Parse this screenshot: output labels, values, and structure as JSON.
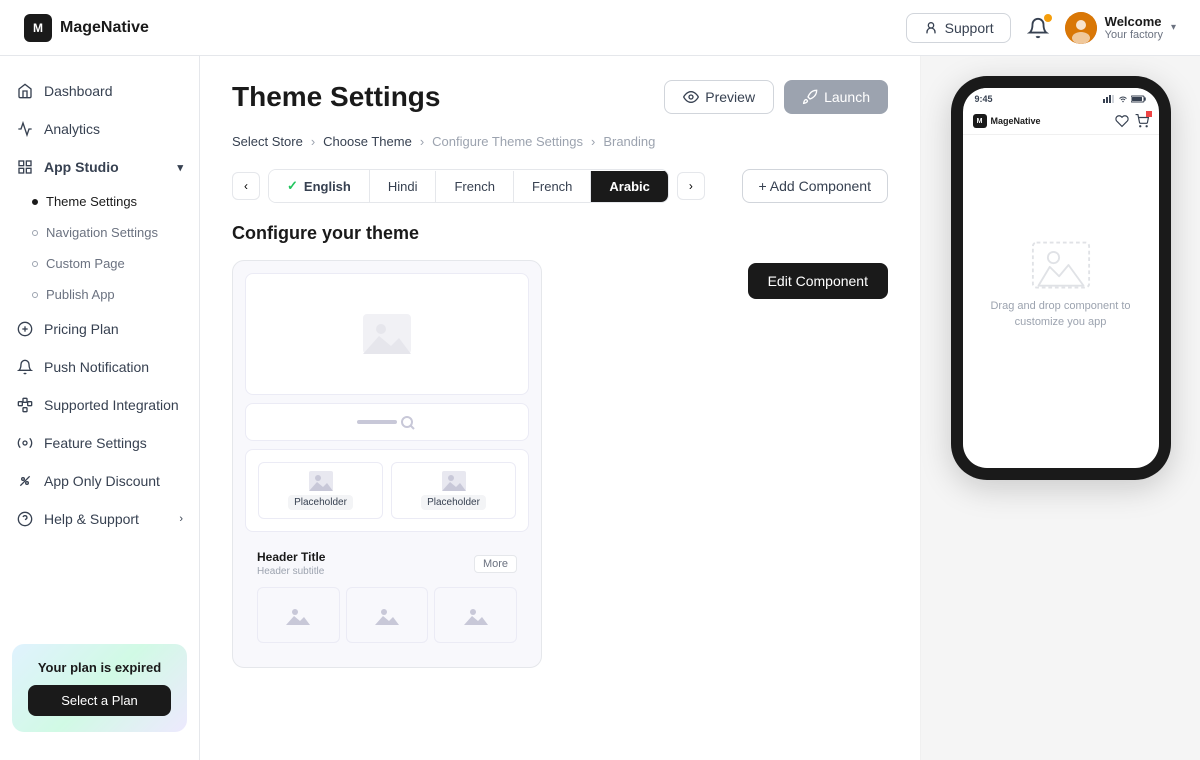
{
  "topbar": {
    "logo_text": "MageNative",
    "support_label": "Support",
    "user_welcome": "Welcome",
    "user_factory": "Your factory"
  },
  "sidebar": {
    "items": [
      {
        "id": "dashboard",
        "label": "Dashboard",
        "icon": "home-icon"
      },
      {
        "id": "analytics",
        "label": "Analytics",
        "icon": "analytics-icon"
      },
      {
        "id": "app-studio",
        "label": "App Studio",
        "icon": "app-studio-icon",
        "has_chevron": true,
        "expanded": true
      },
      {
        "id": "pricing-plan",
        "label": "Pricing Plan",
        "icon": "pricing-icon"
      },
      {
        "id": "push-notification",
        "label": "Push Notification",
        "icon": "bell-icon"
      },
      {
        "id": "supported-integration",
        "label": "Supported Integration",
        "icon": "integration-icon"
      },
      {
        "id": "feature-settings",
        "label": "Feature Settings",
        "icon": "feature-icon"
      },
      {
        "id": "app-only-discount",
        "label": "App Only Discount",
        "icon": "discount-icon"
      },
      {
        "id": "help-support",
        "label": "Help & Support",
        "icon": "help-icon",
        "has_chevron": true
      }
    ],
    "sub_items": [
      {
        "id": "theme-settings",
        "label": "Theme Settings",
        "active": true
      },
      {
        "id": "navigation-settings",
        "label": "Navigation Settings"
      },
      {
        "id": "custom-page",
        "label": "Custom Page"
      },
      {
        "id": "publish-app",
        "label": "Publish App"
      }
    ],
    "plan_card": {
      "expired_text": "Your plan is expired",
      "btn_label": "Select a Plan"
    }
  },
  "content": {
    "page_title": "Theme Settings",
    "preview_btn": "Preview",
    "launch_btn": "Launch",
    "breadcrumb": [
      {
        "label": "Select Store",
        "active": true
      },
      {
        "label": "Choose Theme",
        "active": true
      },
      {
        "label": "Configure Theme Settings",
        "active": false
      },
      {
        "label": "Branding",
        "active": false
      }
    ],
    "lang_tabs": [
      {
        "label": "English",
        "style": "active-light",
        "checked": true
      },
      {
        "label": "Hindi",
        "style": "normal"
      },
      {
        "label": "French",
        "style": "normal"
      },
      {
        "label": "French",
        "style": "normal"
      },
      {
        "label": "Arabic",
        "style": "active-dark"
      }
    ],
    "add_component_label": "+ Add Component",
    "configure_title": "Configure your theme",
    "edit_component_label": "Edit Component",
    "canvas": {
      "product_placeholders": [
        "Placeholder",
        "Placeholder"
      ],
      "header_title": "Header Title",
      "header_subtitle": "Header subtitle",
      "more_label": "More"
    }
  },
  "phone": {
    "status_time": "9:45",
    "app_name": "MageNative",
    "drag_text": "Drag and drop component to customize you app"
  }
}
